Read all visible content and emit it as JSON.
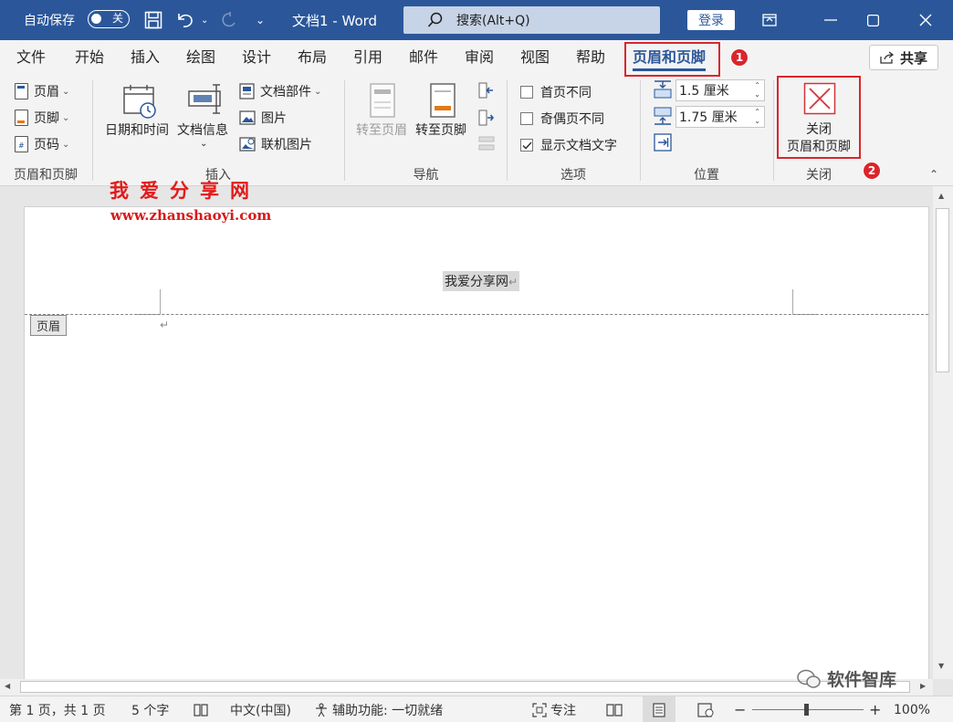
{
  "titlebar": {
    "autosave_label": "自动保存",
    "autosave_state": "关",
    "doc_title": "文档1 - Word",
    "search_placeholder": "搜索(Alt+Q)",
    "login_label": "登录"
  },
  "tabs": [
    "文件",
    "开始",
    "插入",
    "绘图",
    "设计",
    "布局",
    "引用",
    "邮件",
    "审阅",
    "视图",
    "帮助",
    "页眉和页脚"
  ],
  "share_label": "共享",
  "badges": [
    "1",
    "2"
  ],
  "ribbon": {
    "hf_group": {
      "label": "页眉和页脚",
      "items": [
        "页眉",
        "页脚",
        "页码"
      ]
    },
    "insert_group": {
      "label": "插入",
      "datetime": "日期和时间",
      "docinfo": "文档信息",
      "parts": "文档部件",
      "picture": "图片",
      "online_picture": "联机图片"
    },
    "nav_group": {
      "label": "导航",
      "goto_header": "转至页眉",
      "goto_footer": "转至页脚"
    },
    "options_group": {
      "label": "选项",
      "first_page": "首页不同",
      "odd_even": "奇偶页不同",
      "show_text": "显示文档文字"
    },
    "position_group": {
      "label": "位置",
      "header_pos": "1.5 厘米",
      "footer_pos": "1.75 厘米"
    },
    "close_group": {
      "label": "关闭",
      "close_line1": "关闭",
      "close_line2": "页眉和页脚"
    }
  },
  "watermark": {
    "cn": "我爱分享网",
    "url": "www.zhanshaoyi.com"
  },
  "document": {
    "header_text": "我爱分享网",
    "header_tag": "页眉"
  },
  "corner_brand": "软件智库",
  "statusbar": {
    "page": "第 1 页，共 1 页",
    "words": "5 个字",
    "language": "中文(中国)",
    "accessibility": "辅助功能: 一切就绪",
    "focus": "专注",
    "zoom": "100%"
  },
  "colors": {
    "brand": "#2b579a",
    "highlight_red": "#d9262c"
  }
}
